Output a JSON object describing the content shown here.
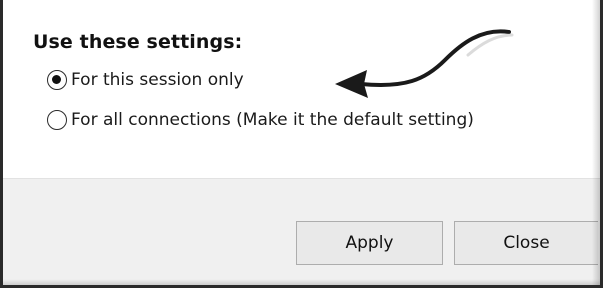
{
  "settings": {
    "heading": "Use these settings:",
    "options": [
      {
        "label": "For this session only",
        "selected": true
      },
      {
        "label": "For all connections (Make it the default setting)",
        "selected": false
      }
    ]
  },
  "buttons": {
    "apply_label": "Apply",
    "close_label": "Close"
  },
  "annotation": {
    "arrow_color": "#1a1a1a",
    "points_to": "For this session only"
  },
  "colors": {
    "footer_bg": "#f0f0f0",
    "button_bg": "#e9e9e9",
    "frame_border": "#2a2a2a"
  }
}
